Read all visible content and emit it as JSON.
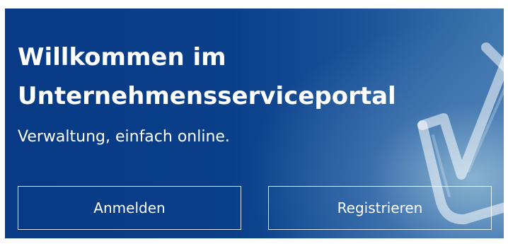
{
  "hero": {
    "title": "Willkommen im Unternehmensserviceportal",
    "subtitle": "Verwaltung, einfach online.",
    "decoration_icon": "checkmark-icon"
  },
  "actions": {
    "login_label": "Anmelden",
    "register_label": "Registrieren"
  },
  "colors": {
    "brand_blue": "#0a3f8a",
    "text": "#ffffff"
  }
}
